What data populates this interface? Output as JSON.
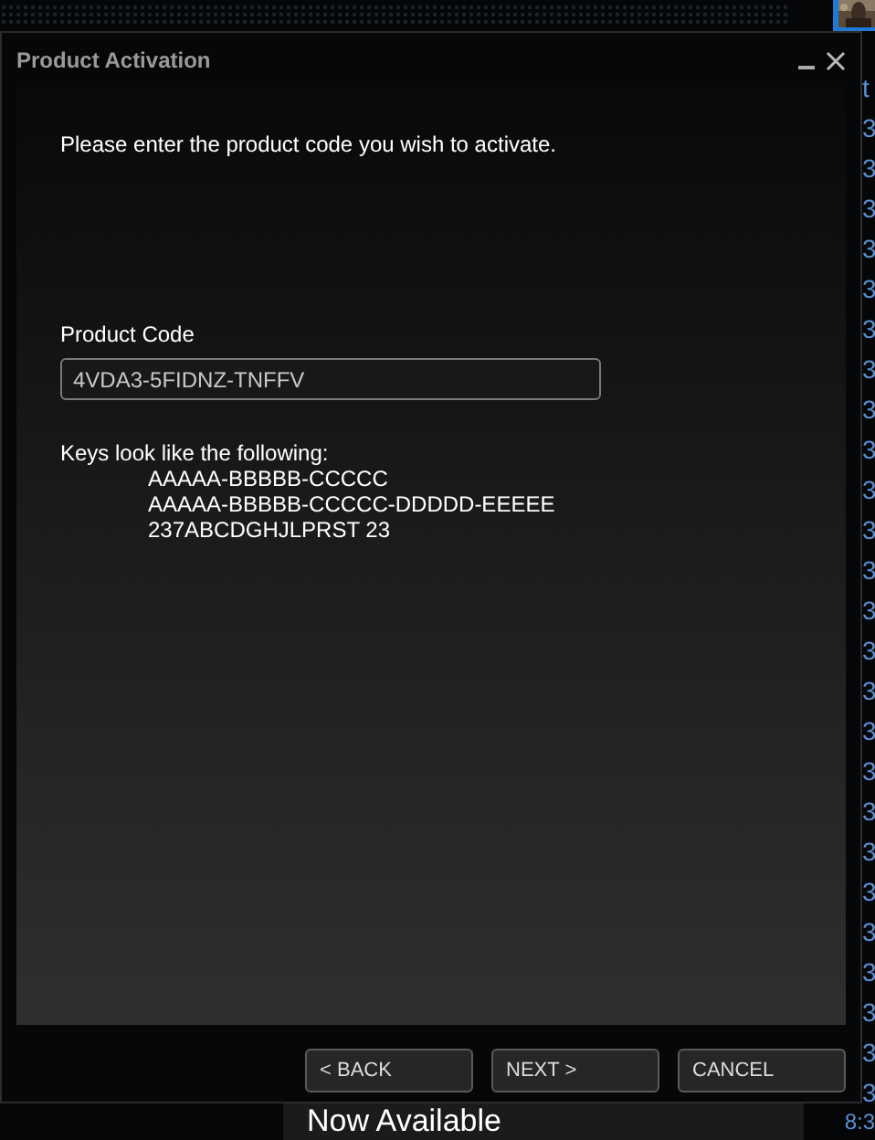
{
  "window": {
    "title": "Product Activation"
  },
  "intro": "Please enter the product code you wish to activate.",
  "product_code": {
    "label": "Product Code",
    "value": "4VDA3-5FIDNZ-TNFFV"
  },
  "examples": {
    "heading": "Keys look like the following:",
    "lines": [
      "AAAAA-BBBBB-CCCCC",
      "AAAAA-BBBBB-CCCCC-DDDDD-EEEEE",
      "237ABCDGHJLPRST 23"
    ]
  },
  "buttons": [
    "< BACK",
    "NEXT >",
    "CANCEL"
  ],
  "background": {
    "side_column": [
      "t",
      "3",
      "3",
      "3",
      "3",
      "3",
      "3",
      "3",
      "3",
      "3",
      "3",
      "3",
      "3",
      "3",
      "3",
      "3",
      "3",
      "3",
      "3",
      "3",
      "3",
      "3",
      "3",
      "3",
      "3",
      "3"
    ],
    "side_time": "8:3",
    "banner": "Now Available"
  }
}
